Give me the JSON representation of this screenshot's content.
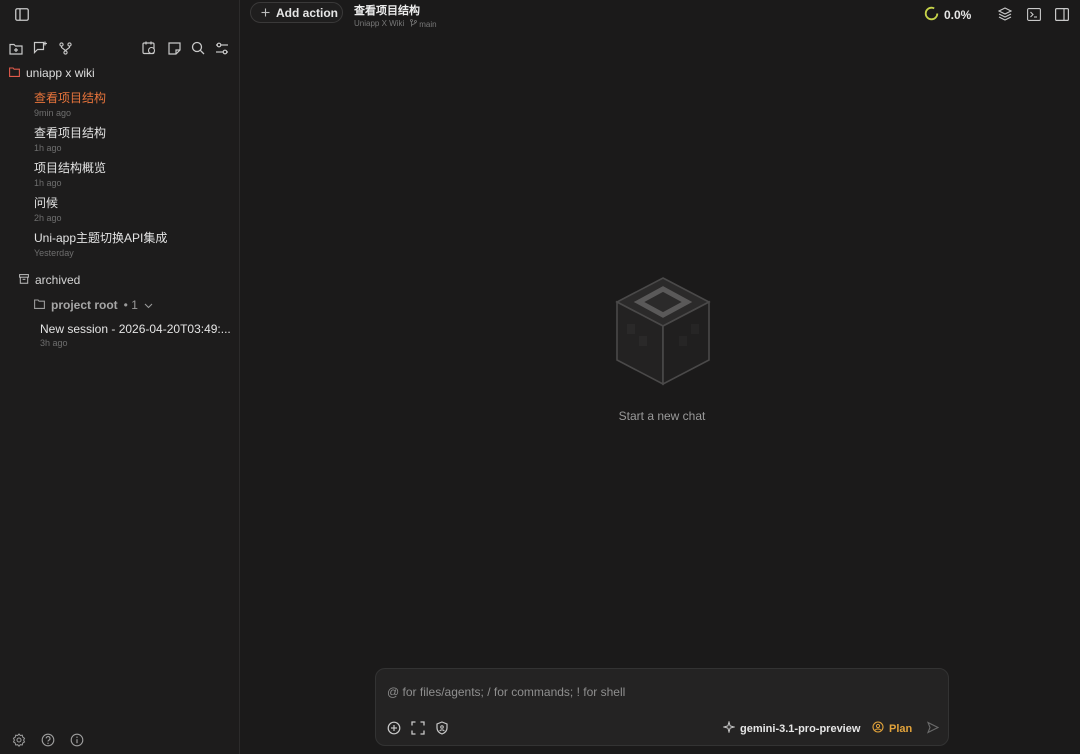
{
  "sidebar": {
    "toolbar_icons": [
      "sidebar-toggle-icon",
      "new-folder-icon",
      "new-chat-icon",
      "branch-icon",
      "calendar-icon",
      "note-icon",
      "search-icon",
      "filter-icon"
    ],
    "project": {
      "name": "uniapp x wiki"
    },
    "sessions": [
      {
        "title": "查看项目结构",
        "time": "9min ago",
        "active": true
      },
      {
        "title": "查看项目结构",
        "time": "1h ago"
      },
      {
        "title": "项目结构概览",
        "time": "1h ago"
      },
      {
        "title": "问候",
        "time": "2h ago"
      },
      {
        "title": "Uni-app主题切换API集成",
        "time": "Yesterday"
      }
    ],
    "archived": {
      "label": "archived",
      "group": {
        "name": "project root",
        "count": "• 1"
      },
      "items": [
        {
          "title": "New session - 2026-04-20T03:49:...",
          "time": "3h ago"
        }
      ]
    }
  },
  "topbar": {
    "add_action": "Add action",
    "title": "查看项目结构",
    "subtitle_project": "Uniapp X Wiki",
    "branch": "main",
    "progress": "0.0%"
  },
  "empty_state": {
    "text": "Start a new chat"
  },
  "composer": {
    "placeholder": "@ for files/agents; / for commands; ! for shell",
    "model": "gemini-3.1-pro-preview",
    "mode": "Plan"
  },
  "colors": {
    "accent": "#e8743b",
    "plan": "#e2a33b",
    "progress": "#c7d44a"
  }
}
